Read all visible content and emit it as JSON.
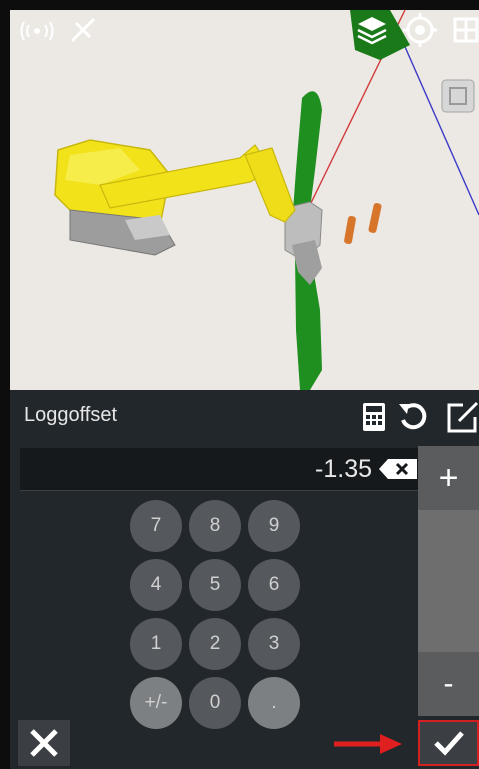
{
  "dialog": {
    "title": "Loggoffset",
    "value": "-1.35"
  },
  "keypad": {
    "row1": [
      "7",
      "8",
      "9"
    ],
    "row2": [
      "4",
      "5",
      "6"
    ],
    "row3": [
      "1",
      "2",
      "3"
    ],
    "row4": [
      "+/-",
      "0",
      "."
    ]
  },
  "side": {
    "plus_label": "+",
    "minus_label": "-"
  },
  "icons": {
    "gps": "gps-signal-icon",
    "satellite": "satellite-icon",
    "layers": "layers-icon",
    "target": "target-icon",
    "calculator": "calculator-icon",
    "undo": "undo-icon",
    "external": "open-external-icon",
    "backspace": "backspace-icon",
    "cancel": "close-icon",
    "confirm": "check-icon",
    "arrow": "red-arrow-icon"
  },
  "colors": {
    "excavator": "#f2e21a",
    "pipe": "#1d9a1d",
    "highlight": "#d42020"
  }
}
